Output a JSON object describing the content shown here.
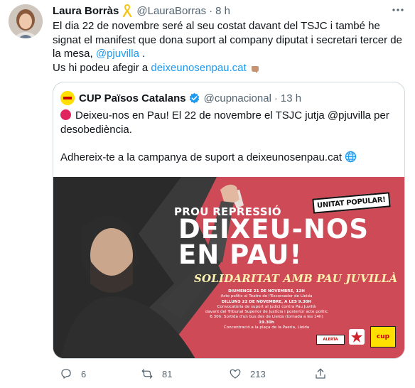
{
  "author": {
    "name": "Laura Borràs",
    "handle": "@LauraBorras",
    "time": "8 h",
    "ribbon_icon": "yellow-ribbon-icon"
  },
  "tweet": {
    "line1": "El dia 22 de novembre seré al seu costat davant del TSJC i també he signat el manifest que dona suport al company diputat i secretari tercer de la mesa, ",
    "mention": "@pjuvilla",
    "line1_end": " .",
    "line2": "Us hi podeu afegir a ",
    "link": "deixeunosenpau.cat"
  },
  "quote": {
    "name": "CUP Països Catalans",
    "handle": "@cupnacional",
    "time": "13 h",
    "text1": "Deixeu-nos en Pau! El 22 de novembre el TSJC jutja @pjuvilla per desobediència.",
    "text2": "Adhereix-te a la campanya de suport a deixeunosenpau.cat"
  },
  "poster": {
    "badge": "UNITAT POPULAR!",
    "kicker": "PROU REPRESSIÓ",
    "title_line1": "DEIXEU-NOS",
    "title_line2": "EN PAU!",
    "subtitle": "SOLIDARITAT AMB PAU JUVILLÀ",
    "ev1_date": "DIUMENGE 21 DE NOVEMBRE, 12H",
    "ev1_desc": "Acte polític al Teatre de l'Escorxador de Lleida",
    "ev2_date": "DILLUNS 22 DE NOVEMBRE, A LES 9.30H",
    "ev2_desc1": "Convocatòria de suport al judici contra Pau Juvillà",
    "ev2_desc2": "davant del Tribunal Superior de Justícia i posterior acte polític",
    "ev2_desc3": "6.30h: Sortida d'un bus des de Lleida (tornada a les 14h)",
    "ev3_date": "19.30h",
    "ev3_desc": "Concentració a la plaça de la Paeria, Lleida",
    "logo_alerta": "ALERTA",
    "logo_cup": "cup"
  },
  "actions": {
    "replies": "6",
    "retweets": "81",
    "likes": "213"
  },
  "colors": {
    "link": "#1d9bf0",
    "muted": "#536471",
    "poster_bg": "#cf4a57",
    "cup_yellow": "#ffe000"
  }
}
